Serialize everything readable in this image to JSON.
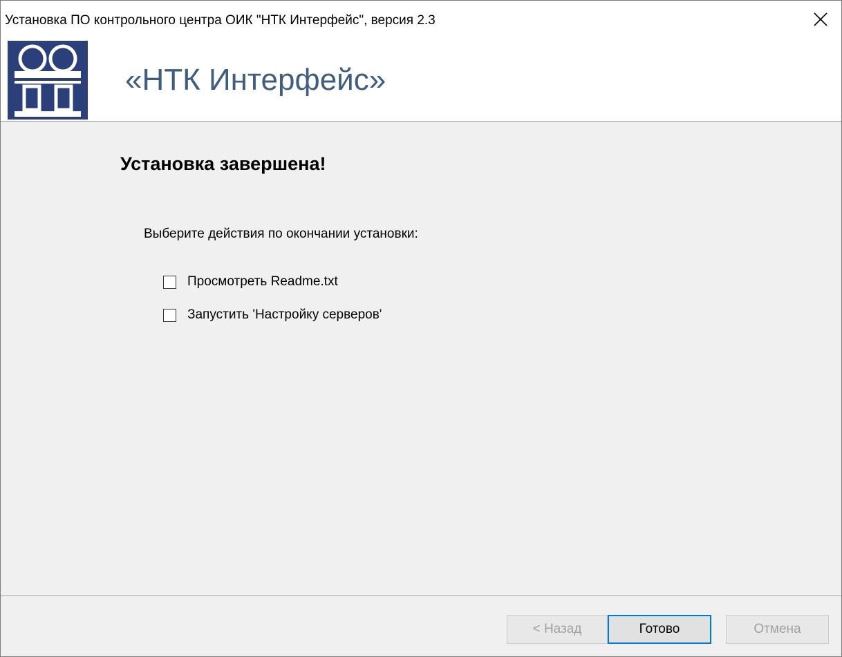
{
  "window": {
    "title": "Установка ПО контрольного центра ОИК \"НТК Интерфейс\", версия 2.3",
    "close_icon": "close-icon"
  },
  "header": {
    "brand": "«НТК Интерфейс»",
    "logo_icon": "ntk-logo-icon",
    "colors": {
      "brand_text": "#3f5e7f",
      "logo_bg": "#2b3f7a"
    }
  },
  "content": {
    "heading": "Установка завершена!",
    "prompt": "Выберите действия по окончании установки:",
    "options": [
      {
        "label": "Просмотреть Readme.txt",
        "checked": false
      },
      {
        "label": "Запустить 'Настройку серверов'",
        "checked": false
      }
    ]
  },
  "footer": {
    "back_label": "< Назад",
    "done_label": "Готово",
    "cancel_label": "Отмена"
  }
}
